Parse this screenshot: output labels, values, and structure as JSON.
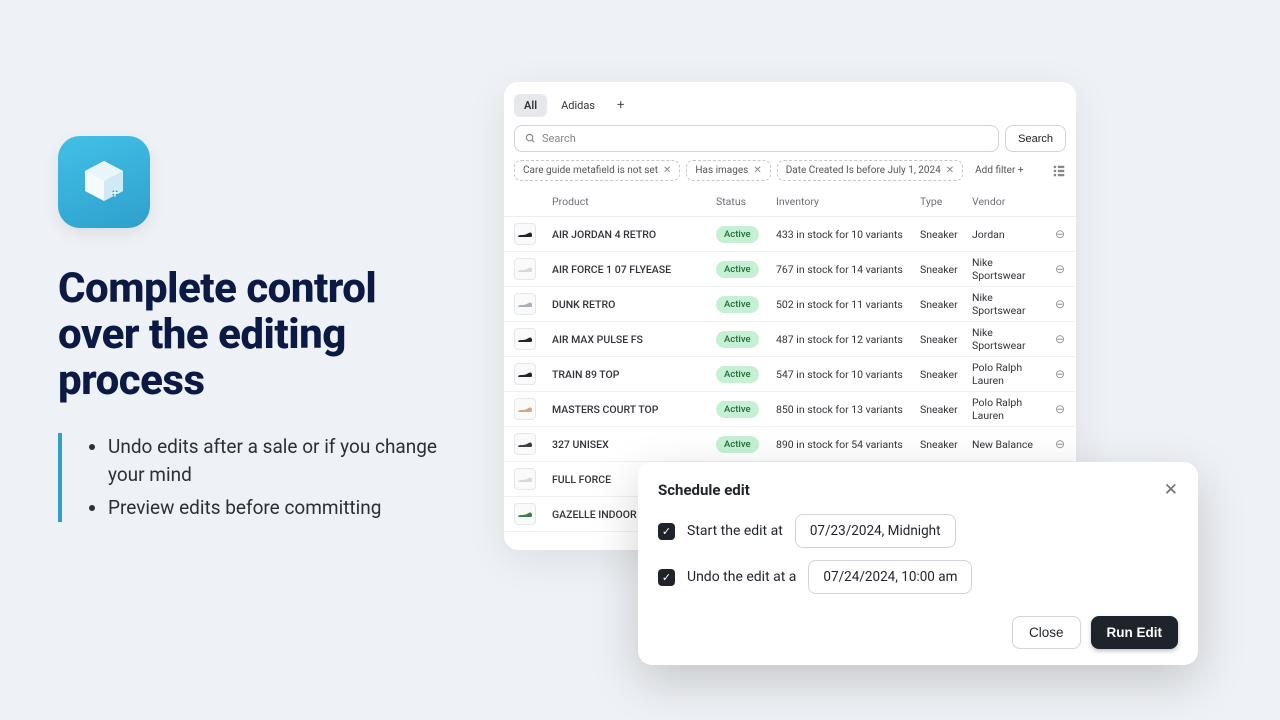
{
  "marketing": {
    "headline": "Complete control over the editing process",
    "bullets": [
      "Undo edits after a sale or if you change your mind",
      "Preview edits before committing"
    ]
  },
  "tabs": {
    "items": [
      {
        "label": "All",
        "active": true
      },
      {
        "label": "Adidas",
        "active": false
      }
    ]
  },
  "search": {
    "placeholder": "Search",
    "button": "Search"
  },
  "filters": {
    "chips": [
      "Care guide metafield is not set",
      "Has images",
      "Date Created Is before July 1, 2024"
    ],
    "add_label": "Add filter +"
  },
  "table": {
    "headers": {
      "product": "Product",
      "status": "Status",
      "inventory": "Inventory",
      "type": "Type",
      "vendor": "Vendor"
    },
    "rows": [
      {
        "name": "AIR JORDAN 4 RETRO",
        "status": "Active",
        "inventory": "433 in stock for 10 variants",
        "type": "Sneaker",
        "vendor": "Jordan",
        "thumb": "#1f232b"
      },
      {
        "name": "AIR FORCE 1 07 FLYEASE",
        "status": "Active",
        "inventory": "767 in stock for 14 variants",
        "type": "Sneaker",
        "vendor": "Nike Sportswear",
        "thumb": "#d7d9de"
      },
      {
        "name": "DUNK RETRO",
        "status": "Active",
        "inventory": "502 in stock for 11 variants",
        "type": "Sneaker",
        "vendor": "Nike Sportswear",
        "thumb": "#a8b0bc"
      },
      {
        "name": "AIR MAX PULSE FS",
        "status": "Active",
        "inventory": "487 in stock for 12 variants",
        "type": "Sneaker",
        "vendor": "Nike Sportswear",
        "thumb": "#1f232b"
      },
      {
        "name": "TRAIN 89 TOP",
        "status": "Active",
        "inventory": "547 in stock for 10 variants",
        "type": "Sneaker",
        "vendor": "Polo Ralph Lauren",
        "thumb": "#1f232b"
      },
      {
        "name": "MASTERS COURT TOP",
        "status": "Active",
        "inventory": "850 in stock for 13 variants",
        "type": "Sneaker",
        "vendor": "Polo Ralph Lauren",
        "thumb": "#cfa88a"
      },
      {
        "name": "327 UNISEX",
        "status": "Active",
        "inventory": "890 in stock for 54 variants",
        "type": "Sneaker",
        "vendor": "New Balance",
        "thumb": "#3b3f48"
      },
      {
        "name": "FULL FORCE",
        "status": "",
        "inventory": "",
        "type": "",
        "vendor": "",
        "thumb": "#d7d9de"
      },
      {
        "name": "GAZELLE INDOOR U",
        "status": "",
        "inventory": "",
        "type": "",
        "vendor": "",
        "thumb": "#3a7d53"
      }
    ]
  },
  "modal": {
    "title": "Schedule edit",
    "start_label": "Start the edit at",
    "start_value": "07/23/2024, Midnight",
    "undo_label": "Undo the edit at a",
    "undo_value": "07/24/2024, 10:00 am",
    "close": "Close",
    "run": "Run Edit"
  }
}
